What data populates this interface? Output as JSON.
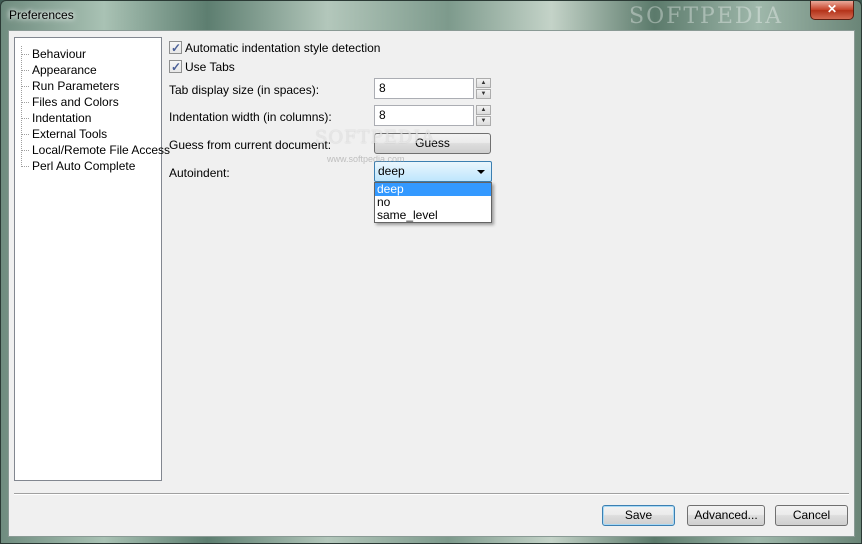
{
  "window": {
    "title": "Preferences",
    "close_glyph": "✕"
  },
  "watermark": {
    "text": "SOFTPEDIA",
    "url": "www.softpedia.com"
  },
  "tree": {
    "items": [
      {
        "label": "Behaviour"
      },
      {
        "label": "Appearance"
      },
      {
        "label": "Run Parameters"
      },
      {
        "label": "Files and Colors"
      },
      {
        "label": "Indentation"
      },
      {
        "label": "External Tools"
      },
      {
        "label": "Local/Remote File Access"
      },
      {
        "label": "Perl Auto Complete"
      }
    ],
    "selected_label": "Indentation"
  },
  "indentation": {
    "auto_detect": {
      "label": "Automatic indentation style detection",
      "checked": true,
      "check_glyph": "✓"
    },
    "use_tabs": {
      "label": "Use Tabs",
      "checked": true,
      "check_glyph": "✓"
    },
    "tab_size": {
      "label": "Tab display size (in spaces):",
      "value": "8"
    },
    "indent_width": {
      "label": "Indentation width (in columns):",
      "value": "8"
    },
    "guess": {
      "label": "Guess from current document:",
      "button_label": "Guess"
    },
    "autoindent": {
      "label": "Autoindent:",
      "value": "deep",
      "options": [
        "deep",
        "no",
        "same_level"
      ]
    },
    "spin_up_glyph": "▲",
    "spin_down_glyph": "▼"
  },
  "footer": {
    "save_label": "Save",
    "advanced_label": "Advanced...",
    "cancel_label": "Cancel"
  },
  "colors": {
    "selection": "#3399ff",
    "default_button_border": "#3c7fb1"
  }
}
